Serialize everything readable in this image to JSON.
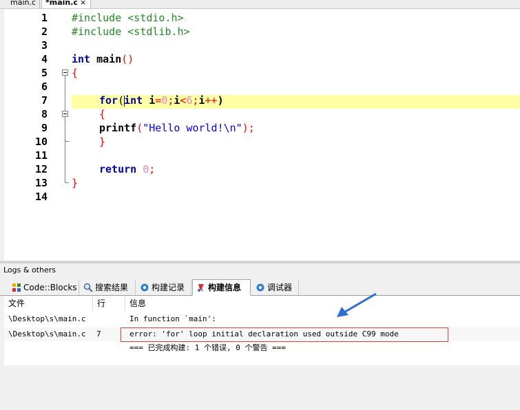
{
  "file_tabs": [
    {
      "label": "main.c"
    },
    {
      "label": "*main.c",
      "close": "×"
    }
  ],
  "editor": {
    "line_numbers": [
      "1",
      "2",
      "3",
      "4",
      "5",
      "6",
      "7",
      "8",
      "9",
      "10",
      "11",
      "12",
      "13",
      "14"
    ],
    "highlighted_line": 7,
    "code": {
      "l1": "#include <stdio.h>",
      "l2": "#include <stdlib.h>",
      "l4_kw": "int",
      "l4_name": " main",
      "l4_paren": "()",
      "l5": "{",
      "l7_for": "for",
      "l7_open": "(",
      "l7_int": "int",
      "l7_i": " i",
      "l7_eq": "=",
      "l7_zero": "0",
      "l7_semi1": ";",
      "l7_i2": "i",
      "l7_lt": "<",
      "l7_six": "6",
      "l7_semi2": ";",
      "l7_i3": "i",
      "l7_inc": "++",
      "l7_close": ")",
      "l8": "{",
      "l9_fn": "printf",
      "l9_open": "(",
      "l9_str": "\"Hello world!\\n\"",
      "l9_close": ");",
      "l10": "}",
      "l12_kw": "return",
      "l12_num": " 0",
      "l12_semi": ";",
      "l13": "}"
    }
  },
  "logs": {
    "title": "Logs & others",
    "tabs": [
      {
        "label": "Code::Blocks",
        "icon": "codeblocks-icon"
      },
      {
        "label": "搜索结果",
        "icon": "magnifier-icon"
      },
      {
        "label": "构建记录",
        "icon": "gear-icon"
      },
      {
        "label": "构建信息",
        "icon": "build-messages-icon",
        "active": true
      },
      {
        "label": "调试器",
        "icon": "debugger-icon"
      }
    ],
    "columns": {
      "file": "文件",
      "line": "行",
      "message": "信息"
    },
    "rows": [
      {
        "file": "\\Desktop\\s\\main.c",
        "line": "",
        "message": "In function `main':"
      },
      {
        "file": "\\Desktop\\s\\main.c",
        "line": "7",
        "message": "error: 'for' loop initial declaration used outside C99 mode"
      },
      {
        "file": "",
        "line": "",
        "message": "=== 已完成构建: 1 个错误, 0 个警告 ==="
      }
    ]
  },
  "colors": {
    "highlight_line": "#ffffa6",
    "error_box": "#e33a3a",
    "annotation_arrow": "#2e6fd6"
  }
}
